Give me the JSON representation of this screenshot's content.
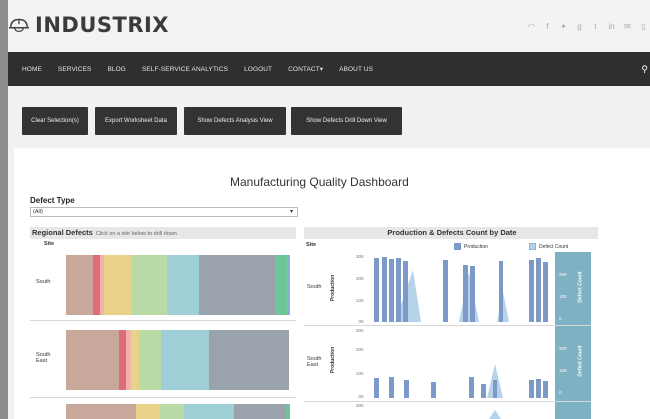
{
  "header": {
    "logo_text": "INDUSTRIX",
    "social_icons": [
      "rss-icon",
      "facebook-icon",
      "twitter-icon",
      "google-plus-icon",
      "tumblr-icon",
      "linkedin-icon",
      "email-icon",
      "tablet-icon"
    ]
  },
  "nav": {
    "items": [
      "HOME",
      "SERVICES",
      "BLOG",
      "SELF-SERVICE ANALYTICS",
      "LOGOUT",
      "CONTACT▾",
      "ABOUT US"
    ]
  },
  "buttons": {
    "clear": "Clear Selection(s)",
    "export": "Export Worksheet Data",
    "analysis": "Show Defects Analysis View",
    "drilldown": "Show Defects Drill Down View"
  },
  "dashboard": {
    "title": "Manufacturing Quality Dashboard",
    "filter_label": "Defect Type",
    "filter_value": "(All)",
    "regional": {
      "title": "Regional Defects",
      "hint": "Click on a site below to drill down",
      "site_header": "Site",
      "sites": [
        "South",
        "South\nEast"
      ]
    },
    "production": {
      "title": "Production & Defects Count by Date",
      "site_header": "Site",
      "legend": [
        "Production",
        "Defect Count"
      ],
      "y_label_left": "Production",
      "y_label_right": "Defect Count",
      "left_ticks": [
        "30K",
        "20K",
        "10K",
        "0K"
      ],
      "right_ticks": [
        "200",
        "100",
        "0"
      ],
      "rows": [
        "South",
        "South\nEast"
      ],
      "bottom_tick": "20K"
    }
  },
  "colors": {
    "navbar": "#2f2f2f",
    "button": "#333333",
    "production": "#7b9ac7",
    "defect": "#b7d3ea",
    "band": "#7eb1c3",
    "segments": [
      "#c9a89c",
      "#e06a7a",
      "#e8d28a",
      "#b9dba6",
      "#9fcfd6",
      "#9aa3ab",
      "#6fc49a",
      "#8db0d9"
    ]
  }
}
